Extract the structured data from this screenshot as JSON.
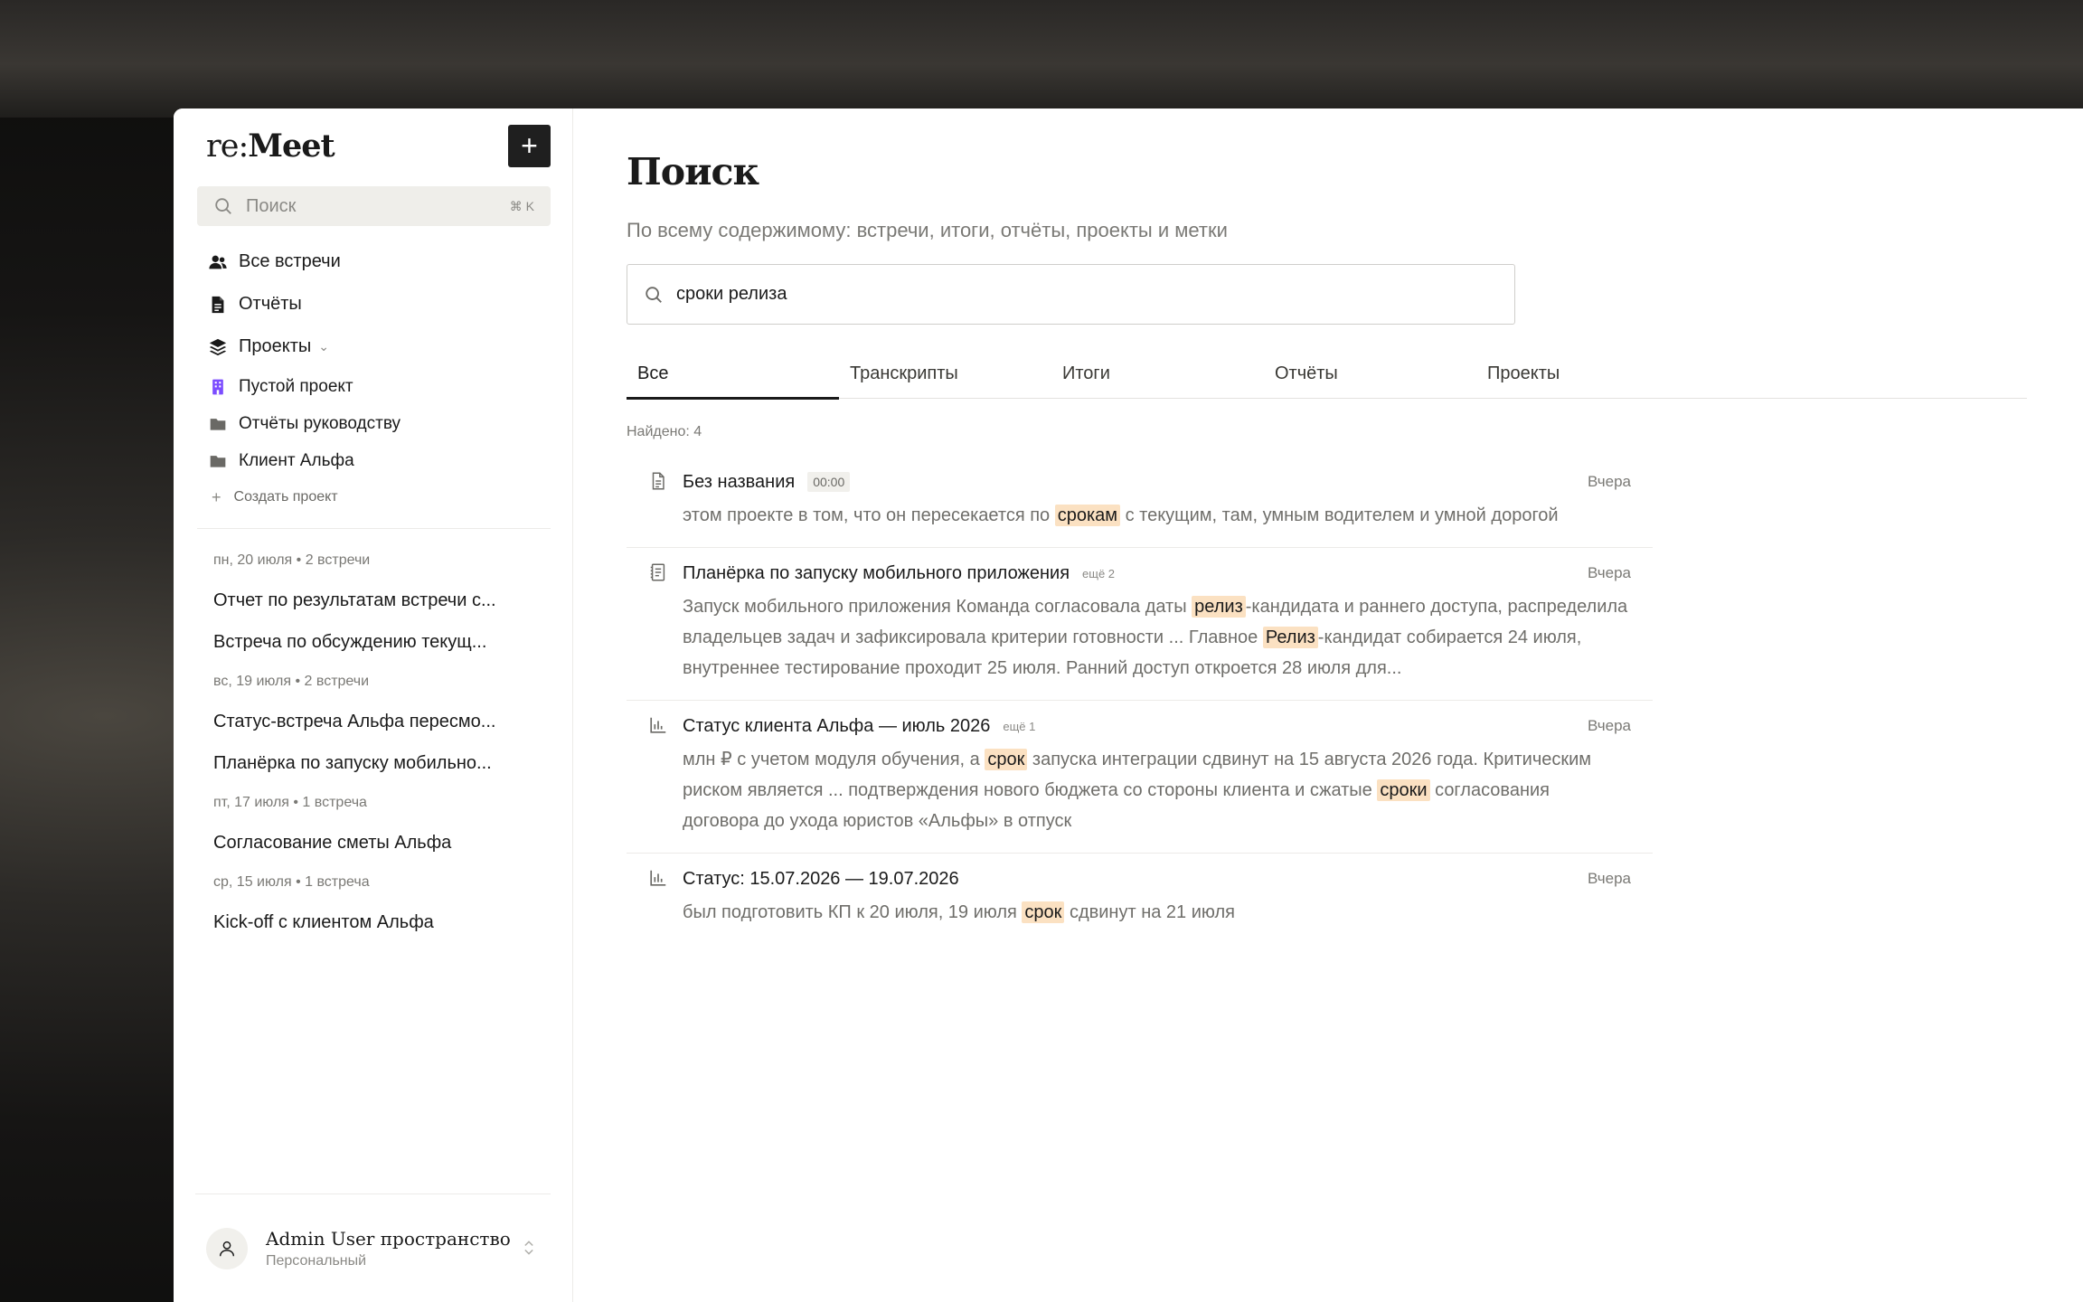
{
  "app": {
    "logo_light": "re:",
    "logo_bold": "Meet",
    "new_button_label": "+"
  },
  "sidebar": {
    "search": {
      "placeholder": "Поиск",
      "shortcut": "⌘ K"
    },
    "nav": [
      {
        "label": "Все встречи",
        "icon": "users-icon"
      },
      {
        "label": "Отчёты",
        "icon": "document-icon"
      },
      {
        "label": "Проекты",
        "icon": "layers-icon",
        "chevron": "⌄"
      }
    ],
    "projects": [
      {
        "label": "Пустой проект",
        "icon": "building-icon",
        "color": "#7c4dff"
      },
      {
        "label": "Отчёты руководству",
        "icon": "folder-icon",
        "color": "#6a6965"
      },
      {
        "label": "Клиент Альфа",
        "icon": "folder-icon",
        "color": "#6a6965"
      }
    ],
    "create_project": {
      "plus": "+",
      "label": "Создать проект"
    },
    "recent": [
      {
        "date": "пн, 20 июля • 2 встречи",
        "items": [
          "Отчет по результатам встречи с...",
          "Встреча по обсуждению текущ..."
        ]
      },
      {
        "date": "вс, 19 июля • 2 встречи",
        "items": [
          "Статус-встреча Альфа пересмо...",
          "Планёрка по запуску мобильно..."
        ]
      },
      {
        "date": "пт, 17 июля • 1 встреча",
        "items": [
          "Согласование сметы Альфа"
        ]
      },
      {
        "date": "ср, 15 июля • 1 встреча",
        "items": [
          "Kick-off с клиентом Альфа"
        ]
      }
    ],
    "workspace": {
      "name": "Admin User пространство",
      "type": "Персональный"
    }
  },
  "main": {
    "title": "Поиск",
    "subtitle": "По всему содержимому: встречи, итоги, отчёты, проекты и метки",
    "query": "сроки релиза",
    "tabs": [
      "Все",
      "Транскрипты",
      "Итоги",
      "Отчёты",
      "Проекты"
    ],
    "active_tab": 0,
    "found": "Найдено: 4",
    "results": [
      {
        "icon": "transcript-icon",
        "title": "Без названия",
        "badge": "00:00",
        "date": "Вчера",
        "snippet": [
          {
            "t": "этом проекте в том, что он пересекается по "
          },
          {
            "t": "срокам",
            "hl": true
          },
          {
            "t": " с текущим, там, умным водителем и умной дорогой"
          }
        ]
      },
      {
        "icon": "summary-icon",
        "title": "Планёрка по запуску мобильного приложения",
        "more": "ещё 2",
        "date": "Вчера",
        "snippet": [
          {
            "t": "Запуск мобильного приложения Команда согласовала даты "
          },
          {
            "t": "релиз",
            "hl": true
          },
          {
            "t": "-кандидата и раннего доступа, распределила владельцев задач и зафиксировала критерии готовности ... Главное "
          },
          {
            "t": "Релиз",
            "hl": true
          },
          {
            "t": "-кандидат собирается 24 июля, внутреннее тестирование проходит 25 июля. Ранний доступ откроется 28 июля для..."
          }
        ]
      },
      {
        "icon": "report-chart-icon",
        "title": "Статус клиента Альфа — июль 2026",
        "more": "ещё 1",
        "date": "Вчера",
        "snippet": [
          {
            "t": "млн ₽ с учетом модуля обучения, а "
          },
          {
            "t": "срок",
            "hl": true
          },
          {
            "t": " запуска интеграции сдвинут на 15 августа 2026 года. Критическим риском является ... подтверждения нового бюджета со стороны клиента и сжатые "
          },
          {
            "t": "сроки",
            "hl": true
          },
          {
            "t": " согласования договора до ухода юристов «Альфы» в отпуск"
          }
        ]
      },
      {
        "icon": "report-chart-icon",
        "title": "Статус: 15.07.2026 — 19.07.2026",
        "date": "Вчера",
        "snippet": [
          {
            "t": "был подготовить КП к 20 июля, 19 июля "
          },
          {
            "t": "срок",
            "hl": true
          },
          {
            "t": " сдвинут на 21 июля"
          }
        ]
      }
    ]
  }
}
